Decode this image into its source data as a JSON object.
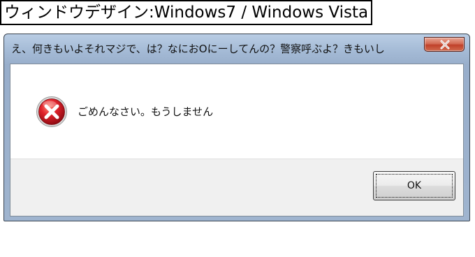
{
  "caption": {
    "text": "ウィンドウデザイン:Windows7 / Windows Vista"
  },
  "dialog": {
    "title": "え、何きもいよそれマジで、は？なにおOにーしてんの？警察呼ぶよ？きもいし",
    "message": "ごめんなさい。もうしません",
    "icon": "error-icon",
    "close_icon": "close-icon",
    "ok_label": "OK"
  },
  "colors": {
    "titlebar": "#a6bcd7",
    "close_button": "#c0412a",
    "error_icon": "#c8102e",
    "footer": "#f0f0f0"
  }
}
